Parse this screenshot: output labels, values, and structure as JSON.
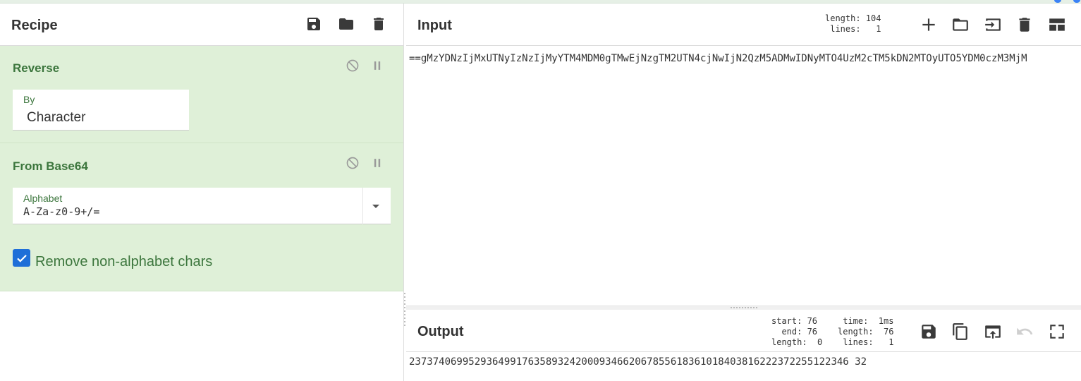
{
  "recipe": {
    "title": "Recipe",
    "operations": [
      {
        "name": "Reverse",
        "field_label": "By",
        "field_value": "Character"
      },
      {
        "name": "From Base64",
        "field_label": "Alphabet",
        "field_value": "A-Za-z0-9+/=",
        "checkbox_label": "Remove non-alphabet chars",
        "checkbox_checked": true
      }
    ]
  },
  "input": {
    "title": "Input",
    "stats": "length: 104\n lines:   1",
    "text": "==gMzYDNzIjMxUTNyIzNzIjMyYTM4MDM0gTMwEjNzgTM2UTN4cjNwIjN2QzM5ADMwIDNyMTO4UzM2cTM5kDN2MTOyUTO5YDM0czM3MjM"
  },
  "output": {
    "title": "Output",
    "stats_left": "start: 76\n  end: 76\nlength:  0",
    "stats_right": " time:  1ms\nlength:  76\n lines:   1",
    "text": "23737406995293649917635893242000934662067855618361018403816222372255122346 32"
  },
  "icons": {
    "save": "save-icon",
    "open": "folder-icon",
    "delete": "trash-icon",
    "add": "plus-icon",
    "disable": "disable-icon",
    "pause": "pause-icon"
  },
  "colors": {
    "op_bg": "#dff0d8",
    "op_text": "#3c763d",
    "checkbox": "#1f6fd8"
  }
}
